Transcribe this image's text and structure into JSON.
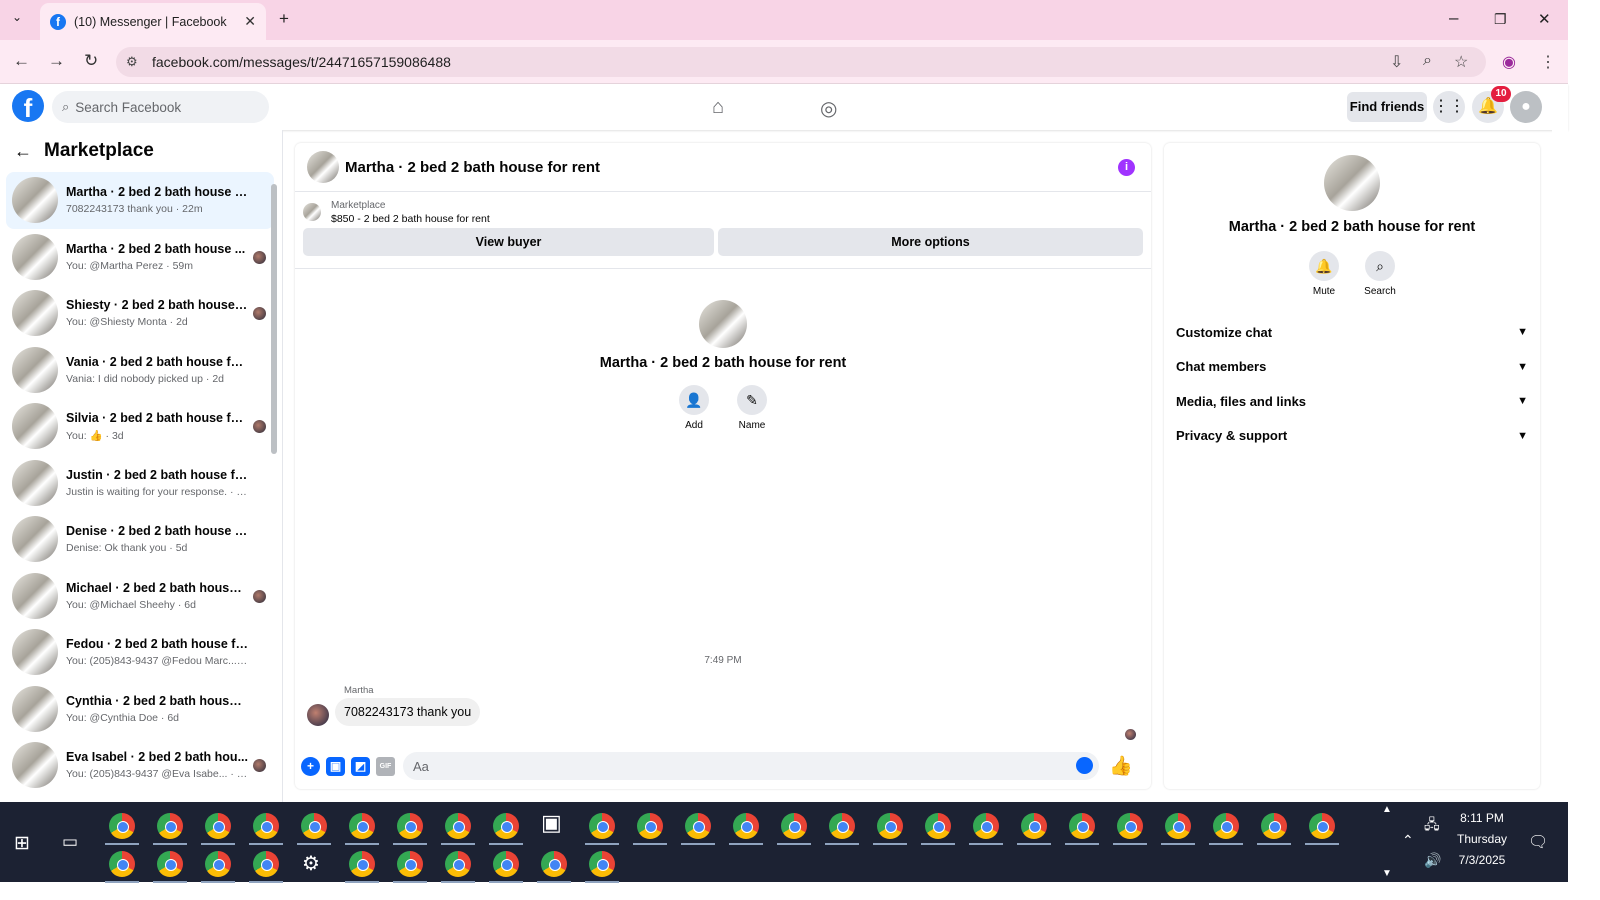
{
  "browser": {
    "tab_title": "(10) Messenger | Facebook",
    "url": "facebook.com/messages/t/24471657159086488"
  },
  "fbnav": {
    "search_placeholder": "Search Facebook",
    "find_friends": "Find friends",
    "notification_count": "10"
  },
  "sidebar": {
    "title": "Marketplace",
    "conversations": [
      {
        "name": "Martha · 2 bed 2 bath house for...",
        "sub": "7082243173 thank you · 22m",
        "active": true
      },
      {
        "name": "Martha · 2 bed 2 bath house ...",
        "sub": "You: @Martha Perez · 59m"
      },
      {
        "name": "Shiesty · 2 bed 2 bath house f...",
        "sub": "You: @Shiesty Monta · 2d"
      },
      {
        "name": "Vania · 2 bed 2 bath house for r...",
        "sub": "Vania: I did nobody picked up · 2d"
      },
      {
        "name": "Silvia · 2 bed 2 bath house fo...",
        "sub": "You: 👍 · 3d"
      },
      {
        "name": "Justin · 2 bed 2 bath house for r...",
        "sub": "Justin is waiting for your response. · 3d"
      },
      {
        "name": "Denise · 2 bed 2 bath house for ...",
        "sub": "Denise: Ok thank you · 5d"
      },
      {
        "name": "Michael · 2 bed 2 bath house ...",
        "sub": "You: @Michael Sheehy · 6d"
      },
      {
        "name": "Fedou · 2 bed 2 bath house for ...",
        "sub": "You: (205)843-9437 @Fedou Marc... · 6d"
      },
      {
        "name": "Cynthia · 2 bed 2 bath house fo...",
        "sub": "You: @Cynthia Doe · 6d"
      },
      {
        "name": "Eva Isabel · 2 bed 2 bath hou...",
        "sub": "You: (205)843-9437 @Eva Isabe... · 6d"
      }
    ]
  },
  "chat": {
    "title": "Martha · 2 bed 2 bath house for rent",
    "marketplace_label": "Marketplace",
    "listing": "$850 - 2 bed 2 bath house for rent",
    "view_buyer": "View buyer",
    "more_options": "More options",
    "intro_name": "Martha · 2 bed 2 bath house for rent",
    "add_label": "Add",
    "name_label": "Name",
    "timestamp": "7:49 PM",
    "sender": "Martha",
    "message": "7082243173 thank you",
    "composer_placeholder": "Aa"
  },
  "info_panel": {
    "name": "Martha · 2 bed 2 bath house for rent",
    "mute": "Mute",
    "search": "Search",
    "sections": [
      "Customize chat",
      "Chat members",
      "Media, files and links",
      "Privacy & support"
    ]
  },
  "taskbar": {
    "time": "8:11 PM",
    "day": "Thursday",
    "date": "7/3/2025"
  },
  "colors": {
    "brand_blue": "#1877f2",
    "messenger_blue": "#0866ff",
    "info_purple": "#a033ff",
    "tab_pink": "#f8d4e6"
  }
}
